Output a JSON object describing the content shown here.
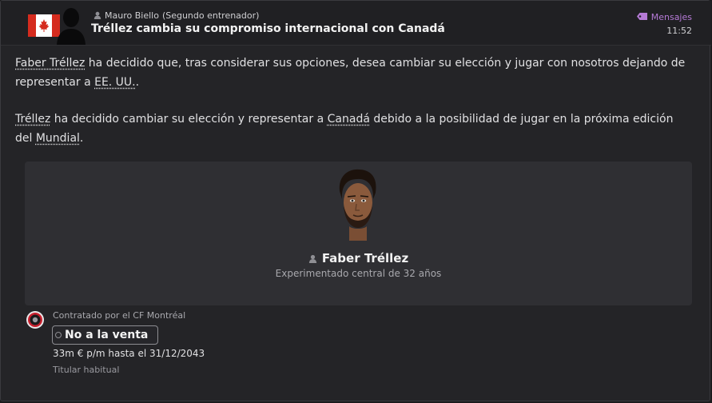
{
  "header": {
    "sender_name": "Mauro Biello",
    "sender_role": "(Segundo entrenador)",
    "subject": "Tréllez cambia su compromiso internacional con Canadá",
    "category": "Mensajes",
    "time": "11:52",
    "flag_country": "Canadá",
    "colors": {
      "accent": "#b57ad6",
      "flag_red": "#d52b1e",
      "flag_white": "#ffffff"
    }
  },
  "body": {
    "p1": [
      {
        "t": "Faber Tréllez",
        "link": true
      },
      {
        "t": " ha decidido que, tras considerar sus opciones, desea cambiar su elección y jugar con nosotros dejando de representar a ",
        "link": false
      },
      {
        "t": "EE. UU.",
        "link": true
      },
      {
        "t": ".",
        "link": false
      }
    ],
    "p2": [
      {
        "t": "Tréllez",
        "link": true
      },
      {
        "t": " ha decidido cambiar su elección y representar a ",
        "link": false
      },
      {
        "t": "Canadá",
        "link": true
      },
      {
        "t": " debido a la posibilidad de jugar en la próxima edición del ",
        "link": false
      },
      {
        "t": "Mundial",
        "link": true
      },
      {
        "t": ".",
        "link": false
      }
    ]
  },
  "player": {
    "name": "Faber Tréllez",
    "description": "Experimentado central de 32 años",
    "contract_label": "Contratado por el CF Montréal",
    "transfer_status": "No a la venta",
    "wage": "33m € p/m hasta el 31/12/2043",
    "squad_role": "Titular habitual",
    "icons": {
      "person": "person-icon",
      "club": "club-badge-icon"
    }
  }
}
